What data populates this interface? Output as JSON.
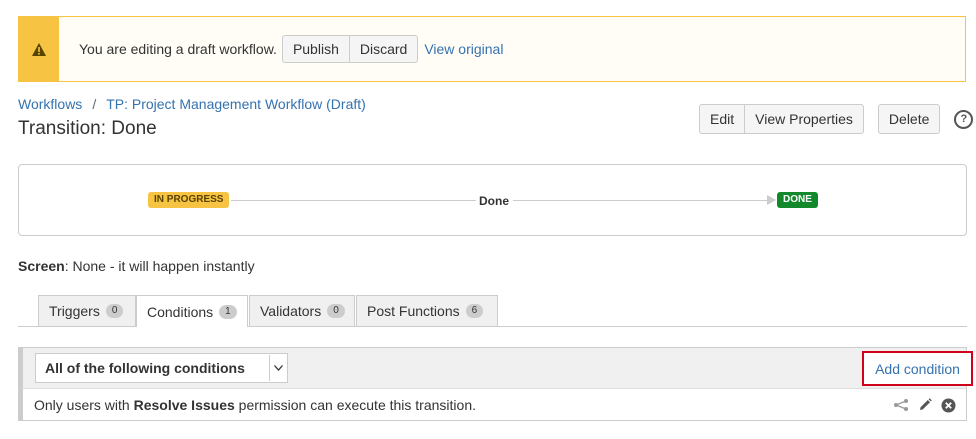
{
  "banner": {
    "message": "You are editing a draft workflow.",
    "publish_label": "Publish",
    "discard_label": "Discard",
    "view_original_label": "View original"
  },
  "breadcrumb": {
    "root": "Workflows",
    "separator": "/",
    "workflow": "TP: Project Management Workflow (Draft)"
  },
  "page": {
    "title": "Transition: Done"
  },
  "actions": {
    "edit_label": "Edit",
    "view_properties_label": "View Properties",
    "delete_label": "Delete",
    "help_glyph": "?"
  },
  "diagram": {
    "from_status": "IN PROGRESS",
    "transition": "Done",
    "to_status": "DONE"
  },
  "screen": {
    "label": "Screen",
    "value": ": None - it will happen instantly"
  },
  "tabs": [
    {
      "label": "Triggers",
      "count": "0"
    },
    {
      "label": "Conditions",
      "count": "1",
      "active": true
    },
    {
      "label": "Validators",
      "count": "0"
    },
    {
      "label": "Post Functions",
      "count": "6"
    }
  ],
  "conditions": {
    "select_value": "All of the following conditions",
    "add_label": "Add condition",
    "rows": [
      {
        "prefix": "Only users with ",
        "bold": "Resolve Issues",
        "suffix": " permission can execute this transition."
      }
    ]
  },
  "colors": {
    "warning": "#f6c342",
    "link": "#3572b0",
    "done": "#14892c",
    "highlight": "#d0021b"
  }
}
